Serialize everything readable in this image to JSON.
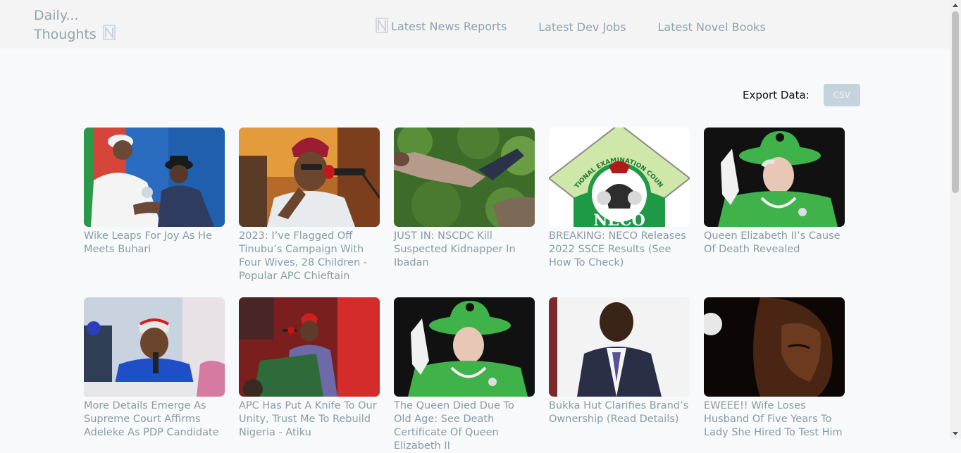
{
  "brand": {
    "line1": "Daily...",
    "line2": "Thoughts",
    "icon": "n-logo-icon"
  },
  "nav": {
    "links": [
      "Latest News Reports",
      "Latest Dev Jobs",
      "Latest Novel Books"
    ]
  },
  "export": {
    "label": "Export Data:",
    "button": "CSV"
  },
  "articles": [
    {
      "title": "Wike Leaps For Joy As He Meets Buhari",
      "image": "two-men-meeting"
    },
    {
      "title": "2023: I’ve Flagged Off Tinubu’s Campaign With Four Wives, 28 Children - Popular APC Chieftain",
      "image": "man-speaking-microphone"
    },
    {
      "title": "JUST IN: NSCDC Kill Suspected Kidnapper In Ibadan",
      "image": "body-in-grass"
    },
    {
      "title": "BREAKING: NECO Releases 2022 SSCE Results (See How To Check)",
      "image": "neco-logo"
    },
    {
      "title": "Queen Elizabeth II’s Cause Of Death Revealed",
      "image": "queen-green-hat"
    },
    {
      "title": "More Details Emerge As Supreme Court Affirms Adeleke As PDP Candidate",
      "image": "man-red-cap-speaking"
    },
    {
      "title": "APC Has Put A Knife To Our Unity, Trust Me To Rebuild Nigeria - Atiku",
      "image": "man-at-podium"
    },
    {
      "title": "The Queen Died Due To Old Age: See Death Certificate Of Queen Elizabeth II",
      "image": "queen-waving"
    },
    {
      "title": "Bukka Hut Clarifies Brand’s Ownership (Read Details)",
      "image": "man-in-suit"
    },
    {
      "title": "EWEEE!! Wife Loses Husband Of Five Years To Lady She Hired To Test Him",
      "image": "crying-woman"
    }
  ]
}
